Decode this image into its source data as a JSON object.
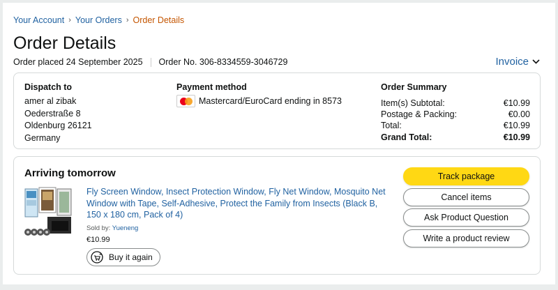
{
  "breadcrumb": {
    "items": [
      "Your Account",
      "Your Orders",
      "Order Details"
    ],
    "separator": "›"
  },
  "page_title": "Order Details",
  "meta": {
    "order_placed": "Order placed 24 September 2025",
    "order_number": "Order No. 306-8334559-3046729"
  },
  "invoice_label": "Invoice",
  "dispatch": {
    "heading": "Dispatch to",
    "lines": [
      "amer al zibak",
      "Oederstraße 8",
      "Oldenburg 26121",
      "Germany"
    ]
  },
  "payment": {
    "heading": "Payment method",
    "card_text": "Mastercard/EuroCard  ending in 8573",
    "card_icon": "mastercard-icon"
  },
  "summary": {
    "heading": "Order Summary",
    "rows": [
      {
        "label": "Item(s) Subtotal:",
        "value": "€10.99"
      },
      {
        "label": "Postage & Packing:",
        "value": "€0.00"
      },
      {
        "label": "Total:",
        "value": "€10.99"
      },
      {
        "label": "Grand Total:",
        "value": "€10.99"
      }
    ]
  },
  "shipment": {
    "status": "Arriving tomorrow",
    "product_title": "Fly Screen Window, Insect Protection Window, Fly Net Window, Mosquito Net Window with Tape, Self-Adhesive, Protect the Family from Insects (Black B, 150 x 180 cm, Pack of 4)",
    "sold_by_label": "Sold by:",
    "seller": "Yueneng",
    "price": "€10.99",
    "buy_again_label": "Buy it again"
  },
  "actions": {
    "track": "Track package",
    "cancel": "Cancel items",
    "ask": "Ask Product Question",
    "review": "Write a product review"
  },
  "colors": {
    "link": "#2162a1",
    "active_crumb": "#c45500",
    "primary_button": "#ffd814"
  }
}
